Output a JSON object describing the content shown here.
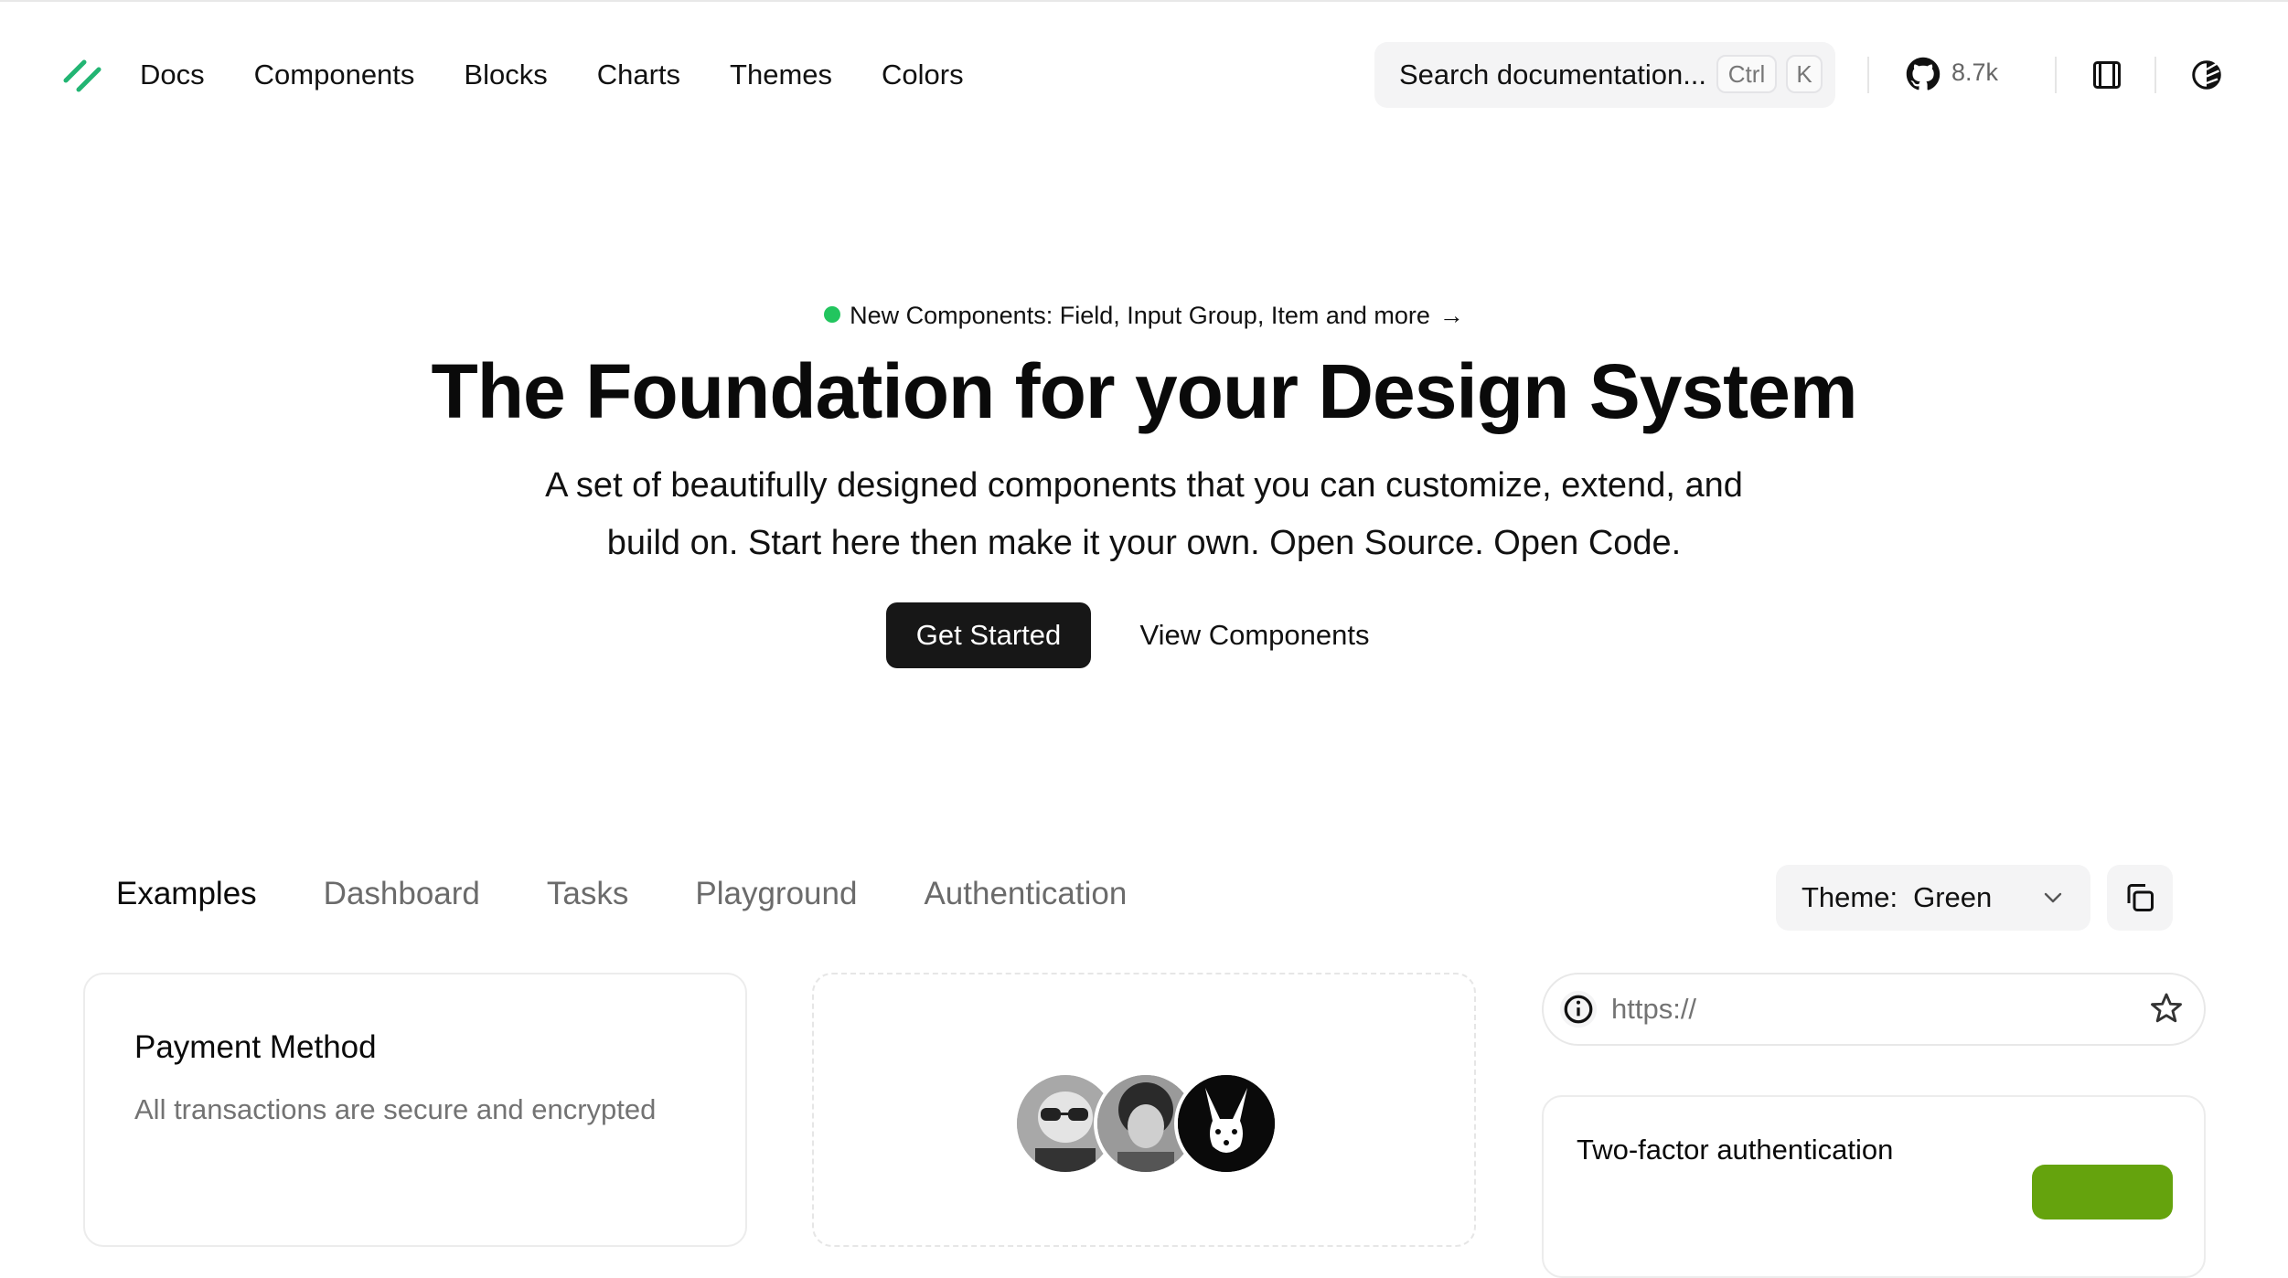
{
  "header": {
    "nav": [
      "Docs",
      "Components",
      "Blocks",
      "Charts",
      "Themes",
      "Colors"
    ],
    "search": {
      "placeholder": "Search documentation...",
      "kbd_ctrl": "Ctrl",
      "kbd_k": "K"
    },
    "github_stars": "8.7k",
    "icons": {
      "logo": "shadcn-logo-icon",
      "github": "github-icon",
      "layout": "layout-toggle-icon",
      "theme": "theme-toggle-icon"
    }
  },
  "hero": {
    "announcement": "New Components: Field, Input Group, Item and more",
    "announcement_arrow": "→",
    "title": "The Foundation for your Design System",
    "subtitle": "A set of beautifully designed components that you can customize, extend, and build on. Start here then make it your own. Open Source. Open Code.",
    "primary_button": "Get Started",
    "secondary_button": "View Components"
  },
  "examples": {
    "tabs": [
      "Examples",
      "Dashboard",
      "Tasks",
      "Playground",
      "Authentication"
    ],
    "active_tab": "Examples",
    "theme_label": "Theme:",
    "theme_value": "Green"
  },
  "cards": {
    "payment_title": "Payment Method",
    "payment_desc": "All transactions are secure and encrypted",
    "url_value": "https://",
    "two_factor_title": "Two-factor authentication"
  },
  "colors": {
    "accent_green": "#22c55e",
    "button_green": "#65a30d",
    "primary": "#171717"
  }
}
